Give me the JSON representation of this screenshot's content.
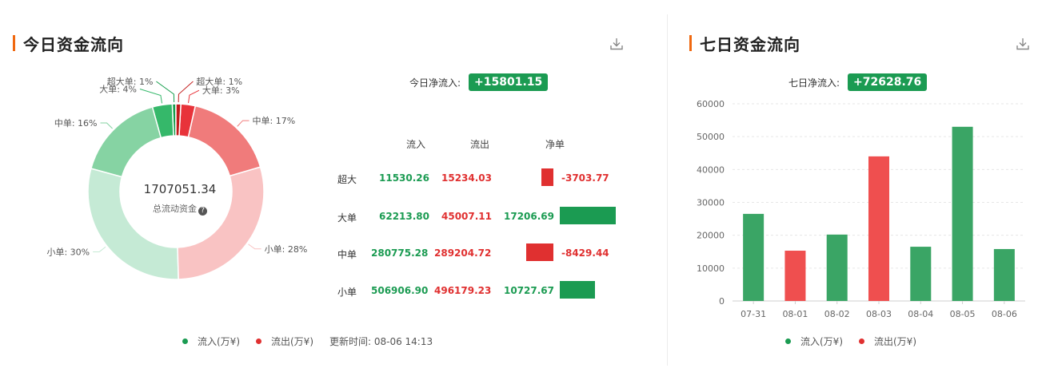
{
  "left": {
    "title": "今日资金流向",
    "net_label": "今日净流入:",
    "net_value": "+15801.15",
    "donut": {
      "center_value": "1707051.34",
      "center_label": "总流动资金",
      "slices": [
        {
          "label": "超大单: 1%",
          "pct": 0.675,
          "color": "#159e4c"
        },
        {
          "label": "大单: 4%",
          "pct": 3.645,
          "color": "#35b86a"
        },
        {
          "label": "中单: 16%",
          "pct": 16.45,
          "color": "#86d3a3"
        },
        {
          "label": "小单: 30%",
          "pct": 29.69,
          "color": "#c5ead5"
        },
        {
          "label": "小单: 28%",
          "pct": 29.065,
          "color": "#f9c3c3"
        },
        {
          "label": "中单: 17%",
          "pct": 16.94,
          "color": "#f07b7b"
        },
        {
          "label": "大单: 3%",
          "pct": 2.64,
          "color": "#e8333a"
        },
        {
          "label": "超大单: 1%",
          "pct": 0.895,
          "color": "#c21b1b"
        }
      ]
    },
    "table": {
      "headers": [
        "流入",
        "流出",
        "净单"
      ],
      "rows": [
        {
          "label": "超大",
          "in": "11530.26",
          "out": "15234.03",
          "net": "-3703.77",
          "net_num": -3703.77
        },
        {
          "label": "大单",
          "in": "62213.80",
          "out": "45007.11",
          "net": "17206.69",
          "net_num": 17206.69
        },
        {
          "label": "中单",
          "in": "280775.28",
          "out": "289204.72",
          "net": "-8429.44",
          "net_num": -8429.44
        },
        {
          "label": "小单",
          "in": "506906.90",
          "out": "496179.23",
          "net": "10727.67",
          "net_num": 10727.67
        }
      ]
    },
    "legend": {
      "in_label": "流入(万¥)",
      "out_label": "流出(万¥)",
      "update_time": "更新时间: 08-06 14:13"
    }
  },
  "right": {
    "title": "七日资金流向",
    "net_label": "七日净流入:",
    "net_value": "+72628.76",
    "legend": {
      "in_label": "流入(万¥)",
      "out_label": "流出(万¥)"
    }
  },
  "colors": {
    "green": "#1b9b52",
    "red": "#e03030",
    "bar_green": "#3aa565",
    "bar_red": "#ef4f4f",
    "accent": "#f0680f"
  },
  "chart_data": {
    "type": "bar",
    "categories": [
      "07-31",
      "08-01",
      "08-02",
      "08-03",
      "08-04",
      "08-05",
      "08-06"
    ],
    "values": [
      26500,
      15300,
      20200,
      44000,
      16500,
      53000,
      15800
    ],
    "direction": [
      "流入",
      "流出",
      "流入",
      "流出",
      "流入",
      "流入",
      "流入"
    ],
    "yticks": [
      0,
      10000,
      20000,
      30000,
      40000,
      50000,
      60000
    ],
    "ylim": [
      0,
      60000
    ],
    "grid": true,
    "legend": "bottom"
  }
}
